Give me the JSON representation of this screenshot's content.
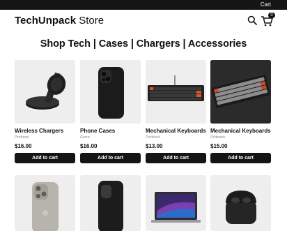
{
  "topbar": {
    "cart_label": "Cart"
  },
  "header": {
    "brand_bold": "TechUnpack",
    "brand_rest": " Store",
    "search_icon": "search-icon",
    "cart_icon": "shopping-cart-icon",
    "cart_count": "0"
  },
  "headline": "Shop Tech | Cases | Chargers | Accessories",
  "products": [
    {
      "name": "Wireless Chargers",
      "vendor": "Prehese",
      "price": "$16.00",
      "button": "Add to cart"
    },
    {
      "name": "Phone Cases",
      "vendor": "Gerre",
      "price": "$16.00",
      "button": "Add to cart"
    },
    {
      "name": "Mechanical Keyboards",
      "vendor": "Perkinet",
      "price": "$13.00",
      "button": "Add to cart"
    },
    {
      "name": "Mechanical Keyboards",
      "vendor": "Ordenek",
      "price": "$15.00",
      "button": "Add to cart"
    }
  ],
  "products_row2": [
    {
      "image": "silver-smartphone"
    },
    {
      "image": "black-phone-case"
    },
    {
      "image": "laptop"
    },
    {
      "image": "wireless-earbuds-case"
    }
  ],
  "colors": {
    "dark": "#151515",
    "card_bg": "#eeeeee"
  }
}
